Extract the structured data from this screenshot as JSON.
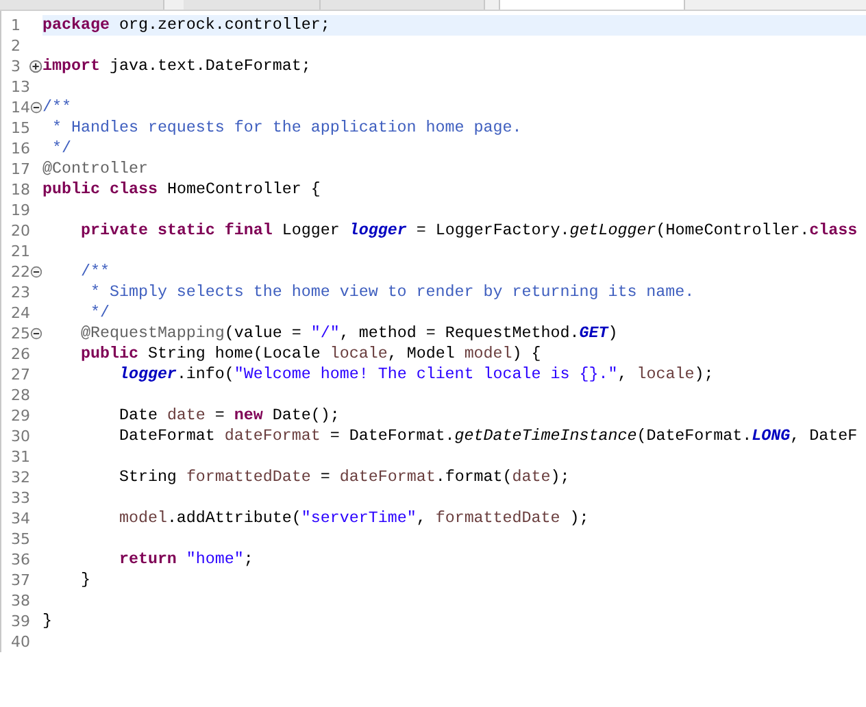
{
  "editor_tabs": [
    {
      "selected": false
    },
    {
      "selected": false
    },
    {
      "selected": false
    },
    {
      "selected": true
    }
  ],
  "code_lines": [
    {
      "number": "1",
      "current": true,
      "segments": [
        {
          "kind": "keyword",
          "text": "package"
        },
        {
          "kind": "plain",
          "text": " org.zerock.controller;"
        }
      ]
    },
    {
      "number": "2",
      "current": false
    },
    {
      "number": "3",
      "current": false,
      "collapsed": true,
      "segments": [
        {
          "kind": "keyword",
          "text": "import"
        },
        {
          "kind": "plain",
          "text": " java.text.DateFormat;"
        }
      ]
    },
    {
      "number": "13",
      "current": false
    },
    {
      "number": "14",
      "current": false,
      "collapsed": false,
      "segments": [
        {
          "kind": "doc",
          "text": "/**"
        }
      ]
    },
    {
      "number": "15",
      "current": false,
      "segments": [
        {
          "kind": "doc",
          "text": " * Handles requests for the application home page."
        }
      ]
    },
    {
      "number": "16",
      "current": false,
      "segments": [
        {
          "kind": "doc",
          "text": " */"
        }
      ]
    },
    {
      "number": "17",
      "current": false,
      "segments": [
        {
          "kind": "annotation",
          "text": "@Controller"
        }
      ]
    },
    {
      "number": "18",
      "current": false,
      "segments": [
        {
          "kind": "keyword",
          "text": "public"
        },
        {
          "kind": "keyword",
          "text": " class"
        },
        {
          "kind": "plain",
          "text": " HomeController {"
        }
      ]
    },
    {
      "number": "19",
      "current": false
    },
    {
      "number": "20",
      "current": false,
      "segments": [
        {
          "kind": "keyword",
          "text": "    private"
        },
        {
          "kind": "keyword",
          "text": " static"
        },
        {
          "kind": "keyword",
          "text": " final"
        },
        {
          "kind": "plain",
          "text": " Logger "
        },
        {
          "kind": "field",
          "text": "logger"
        },
        {
          "kind": "plain",
          "text": " = LoggerFactory."
        },
        {
          "kind": "static_method",
          "text": "getLogger"
        },
        {
          "kind": "plain",
          "text": "(HomeController."
        },
        {
          "kind": "keyword",
          "text": "class"
        }
      ]
    },
    {
      "number": "21",
      "current": false
    },
    {
      "number": "22",
      "current": false,
      "collapsed": false,
      "segments": [
        {
          "kind": "doc",
          "text": "    /**"
        }
      ]
    },
    {
      "number": "23",
      "current": false,
      "segments": [
        {
          "kind": "doc",
          "text": "     * Simply selects the home view to render by returning its name."
        }
      ]
    },
    {
      "number": "24",
      "current": false,
      "segments": [
        {
          "kind": "doc",
          "text": "     */"
        }
      ]
    },
    {
      "number": "25",
      "current": false,
      "collapsed": false,
      "segments": [
        {
          "kind": "annotation",
          "text": "    @RequestMapping"
        },
        {
          "kind": "plain",
          "text": "(value = "
        },
        {
          "kind": "string",
          "text": "\"/\""
        },
        {
          "kind": "plain",
          "text": ", method = RequestMethod."
        },
        {
          "kind": "static_field",
          "text": "GET"
        },
        {
          "kind": "plain",
          "text": ")"
        }
      ]
    },
    {
      "number": "26",
      "current": false,
      "segments": [
        {
          "kind": "keyword",
          "text": "    public"
        },
        {
          "kind": "plain",
          "text": " String home(Locale "
        },
        {
          "kind": "variable",
          "text": "locale"
        },
        {
          "kind": "plain",
          "text": ", Model "
        },
        {
          "kind": "variable",
          "text": "model"
        },
        {
          "kind": "plain",
          "text": ") {"
        }
      ]
    },
    {
      "number": "27",
      "current": false,
      "segments": [
        {
          "kind": "field",
          "text": "        logger"
        },
        {
          "kind": "plain",
          "text": ".info("
        },
        {
          "kind": "string",
          "text": "\"Welcome home! The client locale is {}.\""
        },
        {
          "kind": "plain",
          "text": ", "
        },
        {
          "kind": "variable",
          "text": "locale"
        },
        {
          "kind": "plain",
          "text": ");"
        }
      ]
    },
    {
      "number": "28",
      "current": false
    },
    {
      "number": "29",
      "current": false,
      "segments": [
        {
          "kind": "plain",
          "text": "        Date "
        },
        {
          "kind": "variable",
          "text": "date"
        },
        {
          "kind": "plain",
          "text": " = "
        },
        {
          "kind": "keyword",
          "text": "new"
        },
        {
          "kind": "plain",
          "text": " Date();"
        }
      ]
    },
    {
      "number": "30",
      "current": false,
      "segments": [
        {
          "kind": "plain",
          "text": "        DateFormat "
        },
        {
          "kind": "variable",
          "text": "dateFormat"
        },
        {
          "kind": "plain",
          "text": " = DateFormat."
        },
        {
          "kind": "static_method",
          "text": "getDateTimeInstance"
        },
        {
          "kind": "plain",
          "text": "(DateFormat."
        },
        {
          "kind": "static_field",
          "text": "LONG"
        },
        {
          "kind": "plain",
          "text": ", DateF"
        }
      ]
    },
    {
      "number": "31",
      "current": false
    },
    {
      "number": "32",
      "current": false,
      "segments": [
        {
          "kind": "plain",
          "text": "        String "
        },
        {
          "kind": "variable",
          "text": "formattedDate"
        },
        {
          "kind": "plain",
          "text": " = "
        },
        {
          "kind": "variable",
          "text": "dateFormat"
        },
        {
          "kind": "plain",
          "text": ".format("
        },
        {
          "kind": "variable",
          "text": "date"
        },
        {
          "kind": "plain",
          "text": ");"
        }
      ]
    },
    {
      "number": "33",
      "current": false
    },
    {
      "number": "34",
      "current": false,
      "segments": [
        {
          "kind": "variable",
          "text": "        model"
        },
        {
          "kind": "plain",
          "text": ".addAttribute("
        },
        {
          "kind": "string",
          "text": "\"serverTime\""
        },
        {
          "kind": "plain",
          "text": ", "
        },
        {
          "kind": "variable",
          "text": "formattedDate"
        },
        {
          "kind": "plain",
          "text": " );"
        }
      ]
    },
    {
      "number": "35",
      "current": false
    },
    {
      "number": "36",
      "current": false,
      "segments": [
        {
          "kind": "keyword",
          "text": "        return"
        },
        {
          "kind": "string",
          "text": " \"home\""
        },
        {
          "kind": "plain",
          "text": ";"
        }
      ]
    },
    {
      "number": "37",
      "current": false,
      "segments": [
        {
          "kind": "plain",
          "text": "    }"
        }
      ]
    },
    {
      "number": "38",
      "current": false
    },
    {
      "number": "39",
      "current": false,
      "segments": [
        {
          "kind": "plain",
          "text": "}"
        }
      ]
    },
    {
      "number": "40",
      "current": false
    }
  ]
}
